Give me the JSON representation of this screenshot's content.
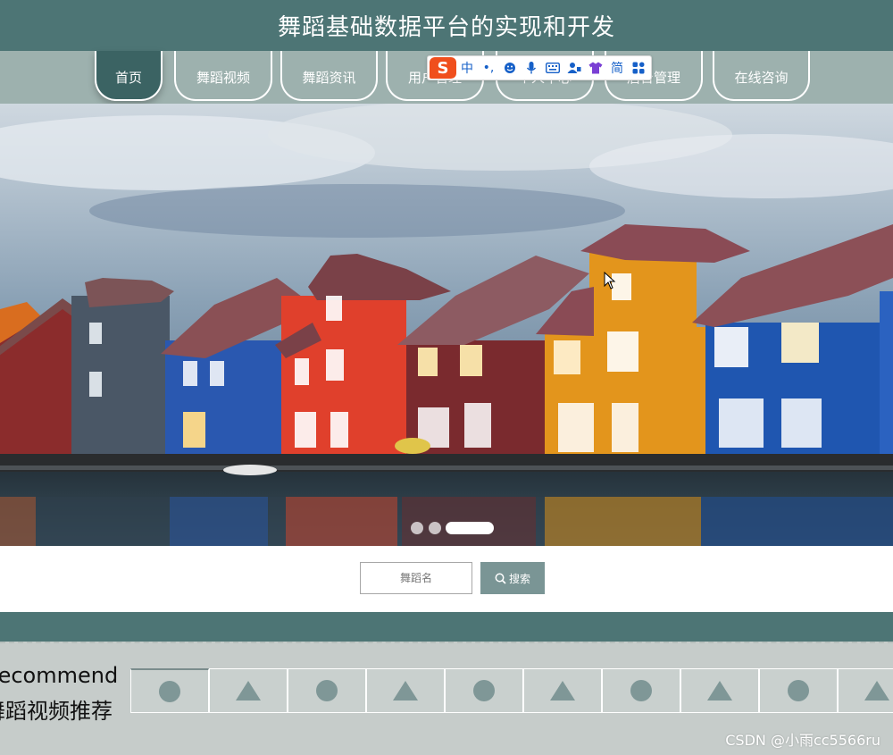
{
  "site": {
    "title": "舞蹈基础数据平台的实现和开发"
  },
  "nav": {
    "items": [
      {
        "label": "首页",
        "active": true
      },
      {
        "label": "舞蹈视频"
      },
      {
        "label": "舞蹈资讯"
      },
      {
        "label": "用户管理"
      },
      {
        "label": "个人中心"
      },
      {
        "label": "后台管理"
      },
      {
        "label": "在线咨询"
      }
    ]
  },
  "ime_toolbar": {
    "logo": "S",
    "mode": "中",
    "punct": "•,",
    "simplified": "简",
    "icons": [
      "sogou-logo-icon",
      "emoji-icon",
      "microphone-icon",
      "keyboard-icon",
      "user-icon",
      "skin-shirt-icon",
      "grid-apps-icon"
    ]
  },
  "carousel": {
    "slide_count": 3,
    "active_index": 2
  },
  "search": {
    "placeholder": "舞蹈名",
    "button_label": "搜索"
  },
  "recommend": {
    "title_en": "Recommend",
    "title_cn": "舞蹈视频推荐",
    "thumbnails": [
      "circle",
      "triangle",
      "circle",
      "triangle",
      "circle",
      "triangle",
      "circle",
      "triangle",
      "circle",
      "triangle"
    ]
  },
  "watermark": "CSDN @小雨cc5566ru",
  "colors": {
    "header": "#4d7575",
    "nav": "#9db1ae",
    "accent": "#7a9595",
    "section_bg": "#c6ccca"
  }
}
